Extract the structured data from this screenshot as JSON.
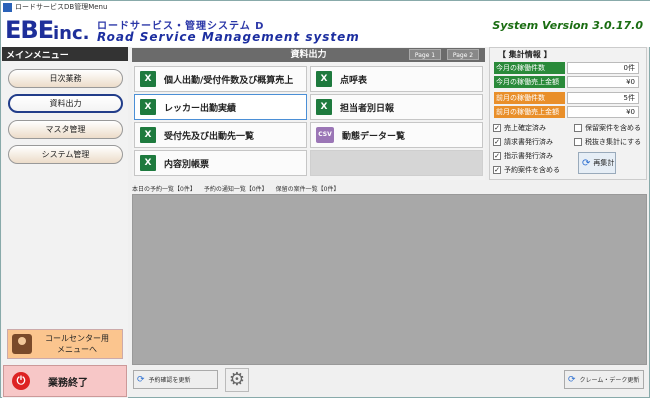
{
  "window": {
    "title": "ロードサービスDB管理Menu"
  },
  "header": {
    "logo_ebe": "EBE",
    "logo_inc": "inc.",
    "logo_jp": "ロードサービス・管理システム D",
    "logo_en": "Road Service Management system",
    "system_version": "System Version 3.0.17.0"
  },
  "sidebar": {
    "title": "メインメニュー",
    "items": [
      {
        "label": "日次業務"
      },
      {
        "label": "資料出力"
      },
      {
        "label": "マスタ管理"
      },
      {
        "label": "システム管理"
      }
    ],
    "callcenter": {
      "line1": "コールセンター用",
      "line2": "メニューへ"
    },
    "quit_label": "業務終了"
  },
  "main": {
    "title": "資料出力",
    "page1": "Page 1",
    "page2": "Page 2",
    "tiles": [
      {
        "label": "個人出勤/受付件数及び概算売上",
        "icon": "X"
      },
      {
        "label": "点呼表",
        "icon": "X"
      },
      {
        "label": "レッカー出勤実績",
        "icon": "X"
      },
      {
        "label": "担当者別日報",
        "icon": "X"
      },
      {
        "label": "受付先及び出動先一覧",
        "icon": "X"
      },
      {
        "label": "動態データー覧",
        "icon": "CSV"
      },
      {
        "label": "内容別帳票",
        "icon": "X"
      }
    ]
  },
  "stats": {
    "title": "【 集計情報 】",
    "rows": [
      {
        "label": "今月の稼働件数",
        "value": "0件"
      },
      {
        "label": "今月の稼働売上金額",
        "value": "¥0"
      },
      {
        "label": "前月の稼働件数",
        "value": "5件"
      },
      {
        "label": "前月の稼働売上金額",
        "value": "¥0"
      }
    ],
    "checks": [
      {
        "label": "売上確定済み",
        "checked": true
      },
      {
        "label": "保留案件を含める",
        "checked": false
      },
      {
        "label": "請求書発行済み",
        "checked": true
      },
      {
        "label": "税抜き集計にする",
        "checked": false
      },
      {
        "label": "指示書発行済み",
        "checked": true
      },
      {
        "label": "予約案件を含める",
        "checked": true
      }
    ],
    "recalc_label": "再集計"
  },
  "tabs": {
    "items": [
      "本日の予約一覧【0件】",
      "予約の通知一覧【0件】",
      "保留の案件一覧【0件】"
    ]
  },
  "bottom": {
    "reserve_update": "予約確認を更新",
    "claim_update": "クレーム・デーク更新"
  },
  "colors": {
    "brand": "#1e2f9a",
    "version_green": "#1a6d12",
    "excel_green": "#1e7a3e",
    "stat_green": "#2a8a3a",
    "stat_orange": "#e98f2a",
    "grid_gray": "#a8a8a8"
  }
}
